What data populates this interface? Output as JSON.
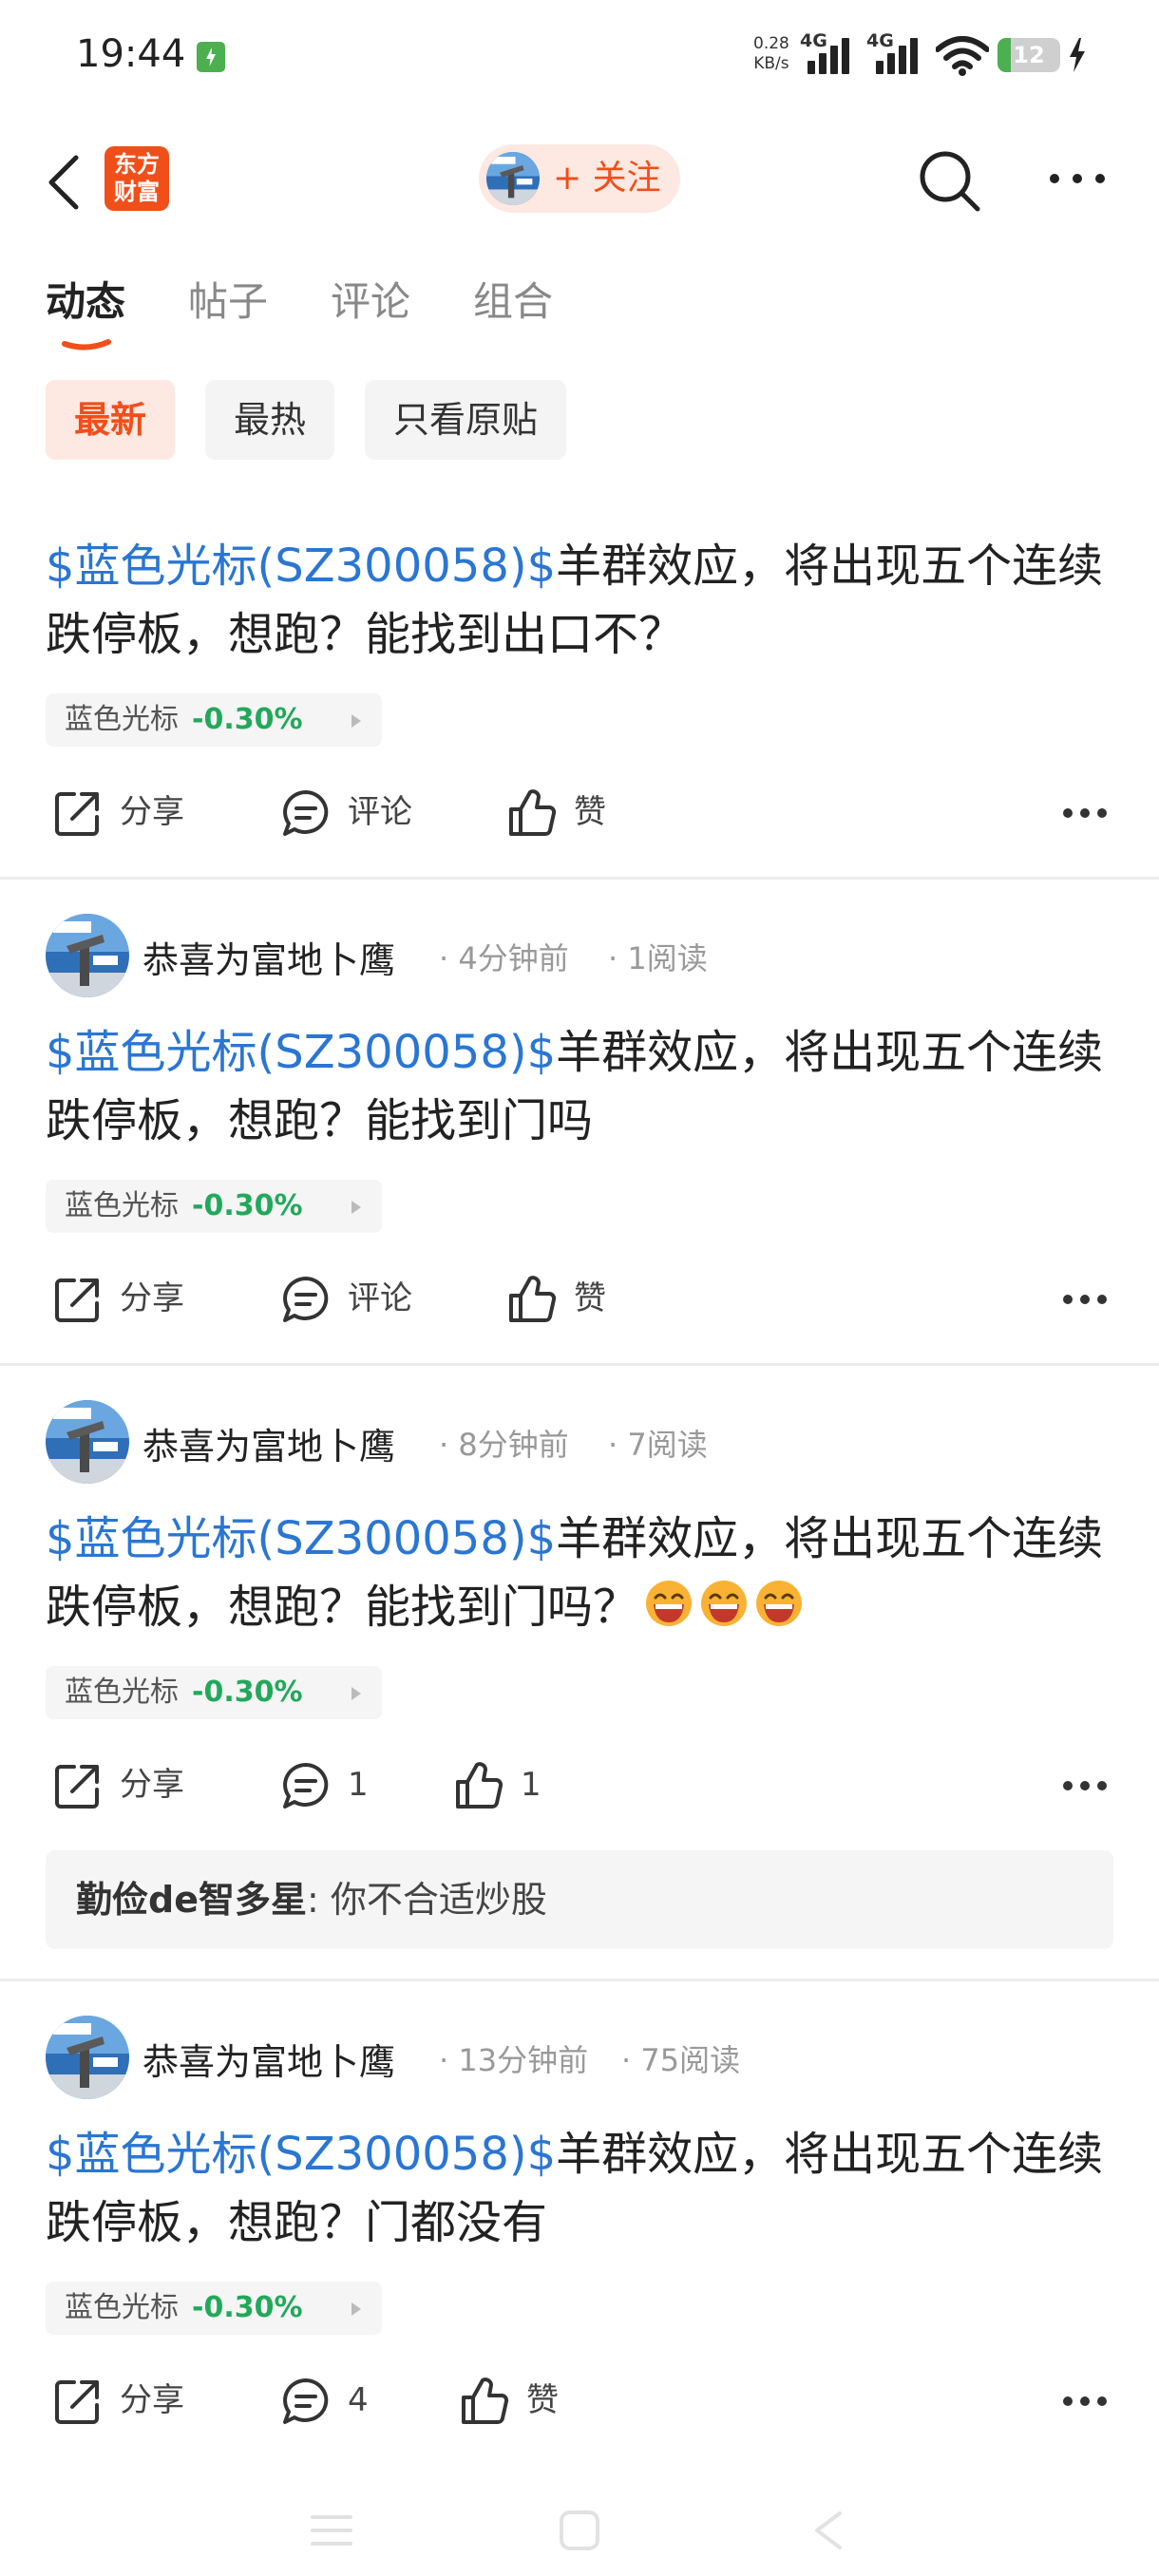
{
  "status_bar": {
    "time": "19:44",
    "net_speed_value": "0.28",
    "net_speed_unit": "KB/s",
    "sim1": "4G",
    "sim2": "4G",
    "battery": "12"
  },
  "header": {
    "logo_line1": "东方",
    "logo_line2": "财富",
    "follow_label": "+ 关注"
  },
  "tabs": [
    "动态",
    "帖子",
    "评论",
    "组合"
  ],
  "filters": [
    "最新",
    "最热",
    "只看原贴"
  ],
  "posts": [
    {
      "stock_link": "$蓝色光标(SZ300058)$",
      "text": "羊群效应，将出现五个连续跌停板，想跑？能找到出口不？",
      "tag_name": "蓝色光标",
      "tag_change": "-0.30%",
      "share": "分享",
      "comment": "评论",
      "like": "赞"
    },
    {
      "author": "恭喜为富地卜鹰",
      "time": "4分钟前",
      "reads": "1阅读",
      "stock_link": "$蓝色光标(SZ300058)$",
      "text": "羊群效应，将出现五个连续跌停板，想跑？能找到门吗",
      "tag_name": "蓝色光标",
      "tag_change": "-0.30%",
      "share": "分享",
      "comment": "评论",
      "like": "赞"
    },
    {
      "author": "恭喜为富地卜鹰",
      "time": "8分钟前",
      "reads": "7阅读",
      "stock_link": "$蓝色光标(SZ300058)$",
      "text": "羊群效应，将出现五个连续跌停板，想跑？能找到门吗？",
      "tag_name": "蓝色光标",
      "tag_change": "-0.30%",
      "share": "分享",
      "comment": "1",
      "like": "1",
      "reply_user": "勤俭de智多星",
      "reply_text": "你不合适炒股"
    },
    {
      "author": "恭喜为富地卜鹰",
      "time": "13分钟前",
      "reads": "75阅读",
      "stock_link": "$蓝色光标(SZ300058)$",
      "text": "羊群效应，将出现五个连续跌停板，想跑？门都没有",
      "tag_name": "蓝色光标",
      "tag_change": "-0.30%",
      "share": "分享",
      "comment": "4",
      "like": "赞"
    }
  ],
  "colors": {
    "accent": "#f04f1a",
    "link": "#2a76d2",
    "down": "#22a85a"
  }
}
